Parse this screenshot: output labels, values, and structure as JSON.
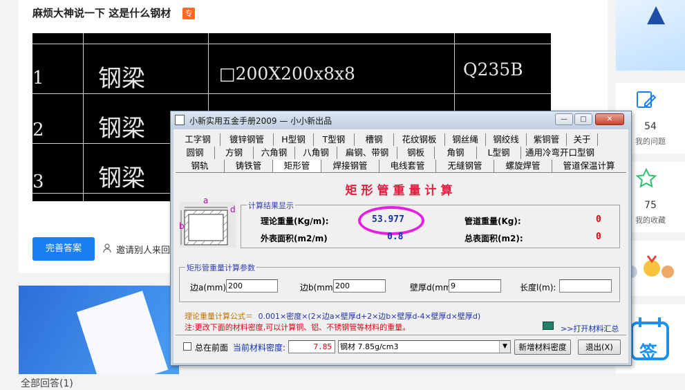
{
  "page": {
    "question_title": "麻烦大神说一下 这是什么钢材",
    "badge": "专",
    "cad": {
      "row1": {
        "num": "1",
        "name": "钢梁",
        "spec": "□200X200x8x8",
        "grade": "Q235B"
      },
      "row2": {
        "num": "2",
        "name": "钢梁"
      },
      "row3": {
        "num": "3",
        "name": "钢梁"
      }
    },
    "perfect_button": "完善答案",
    "invite_text": "邀请别人来回",
    "all_answers": "全部回答(1)",
    "sidebar": {
      "questions_count": "54",
      "questions_label": "我的问题",
      "favorites_count": "75",
      "favorites_label": "我的收藏",
      "sign_label": "签"
    }
  },
  "window": {
    "title": "小新实用五金手册2009 — 小小新出品",
    "minimize": "—",
    "maximize": "□",
    "close": "✕",
    "tabs_row1": [
      "工字钢",
      "镀锌钢管",
      "H型钢",
      "T型钢",
      "槽钢",
      "花纹钢板",
      "钢丝绳",
      "钢绞线",
      "紫铜管",
      "关于"
    ],
    "tabs_row2": [
      "圆钢",
      "方钢",
      "六角钢",
      "八角钢",
      "扁钢、带钢",
      "钢板",
      "角钢",
      "L型钢",
      "通用冷弯开口型钢"
    ],
    "tabs_row3": [
      "钢轨",
      "铸铁管",
      "矩形管",
      "焊接钢管",
      "电线套管",
      "无缝钢管",
      "螺旋焊管",
      "管道保温计算"
    ],
    "panel_title": "矩形管重量计算",
    "diagram": {
      "a": "a",
      "b": "b",
      "d": "d"
    },
    "results": {
      "group_title": "计算结果显示",
      "theoretical_weight_label": "理论重量(Kg/m):",
      "theoretical_weight_value": "53.977",
      "surface_area_label": "外表面积(m2/m)",
      "surface_area_value": "0.8",
      "pipe_weight_label": "管道重量(Kg):",
      "pipe_weight_value": "0",
      "total_area_label": "总表面积(m2):",
      "total_area_value": "0"
    },
    "params": {
      "group_title": "矩形管重量计算参数",
      "side_a_label": "边a(mm):",
      "side_a_value": "200",
      "side_b_label": "边b(mm):",
      "side_b_value": "200",
      "wall_label": "壁厚d(mm):",
      "wall_value": "9",
      "length_label": "长度l(m):",
      "length_value": ""
    },
    "formula_prefix": "理论重量计算公式＝",
    "formula_body": "0.001×密度×(2×边a×壁厚d+2×边b×壁厚d-4×壁厚d×壁厚d)",
    "note": "注:更改下面的材料密度,可以计算铜、铝、不锈钢管等材料的重量。",
    "open_summary": ">>打开材料汇总",
    "always_on_top": "总在前面",
    "density_label": "当前材料密度:",
    "density_value": "7.85",
    "material_select": "钢材 7.85g/cm3",
    "add_density_button": "新增材料密度",
    "exit_button": "退出(X)"
  },
  "colors": {
    "accent_blue": "#1a7ff0",
    "title_red": "#e02040",
    "highlight_magenta": "#e51fe0",
    "value_blue": "#1030b0",
    "value_red": "#e00010"
  }
}
